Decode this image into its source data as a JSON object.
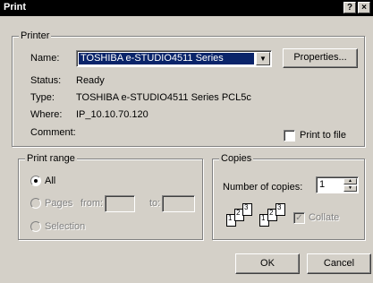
{
  "window": {
    "title": "Print",
    "help_label": "?",
    "close_label": "×"
  },
  "printer": {
    "group_label": "Printer",
    "name_label": "Name:",
    "name_value": "TOSHIBA e-STUDIO4511 Series PCL5c",
    "properties_label": "Properties...",
    "status_label": "Status:",
    "status_value": "Ready",
    "type_label": "Type:",
    "type_value": "TOSHIBA e-STUDIO4511 Series PCL5c",
    "where_label": "Where:",
    "where_value": "IP_10.10.70.120",
    "comment_label": "Comment:",
    "comment_value": "",
    "print_to_file_label": "Print to file",
    "print_to_file_checked": false
  },
  "print_range": {
    "group_label": "Print range",
    "all_label": "All",
    "pages_label": "Pages",
    "from_label": "from:",
    "to_label": "to:",
    "from_value": "",
    "to_value": "",
    "selection_label": "Selection",
    "selected": "All"
  },
  "copies": {
    "group_label": "Copies",
    "number_label": "Number of copies:",
    "number_value": "1",
    "collate_label": "Collate",
    "collate_checked": true,
    "collate_pages": [
      "1",
      "2",
      "3"
    ]
  },
  "footer": {
    "ok_label": "OK",
    "cancel_label": "Cancel"
  }
}
